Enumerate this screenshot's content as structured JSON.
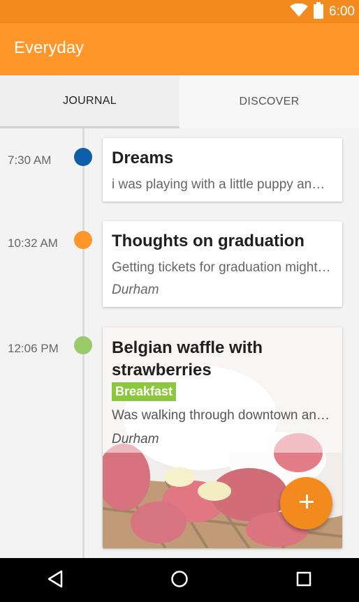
{
  "status_bar": {
    "time": "6:00"
  },
  "app_bar": {
    "title": "Everyday"
  },
  "tabs": [
    {
      "label": "JOURNAL",
      "active": true
    },
    {
      "label": "DISCOVER",
      "active": false
    }
  ],
  "entries": [
    {
      "time": "7:30 AM",
      "dot_color": "#0f5ea8",
      "title": "Dreams",
      "body": "i was playing with a little puppy and it was so cute",
      "location": ""
    },
    {
      "time": "10:32 AM",
      "dot_color": "#ff962a",
      "title": "Thoughts on graduation",
      "body": "Getting tickets for graduation might be tricky this year",
      "location": "Durham"
    },
    {
      "time": "12:06 PM",
      "dot_color": "#9acb6a",
      "title": "Belgian waffle with strawberries",
      "tag": "Breakfast",
      "body": "Was walking through downtown and found a cafe",
      "location": "Durham"
    }
  ],
  "colors": {
    "accent": "#ff962a",
    "status": "#f28a1d",
    "tag": "#8dc63f"
  },
  "icons": [
    "wifi-icon",
    "battery-icon",
    "add-icon",
    "back-icon",
    "home-icon",
    "recents-icon"
  ]
}
